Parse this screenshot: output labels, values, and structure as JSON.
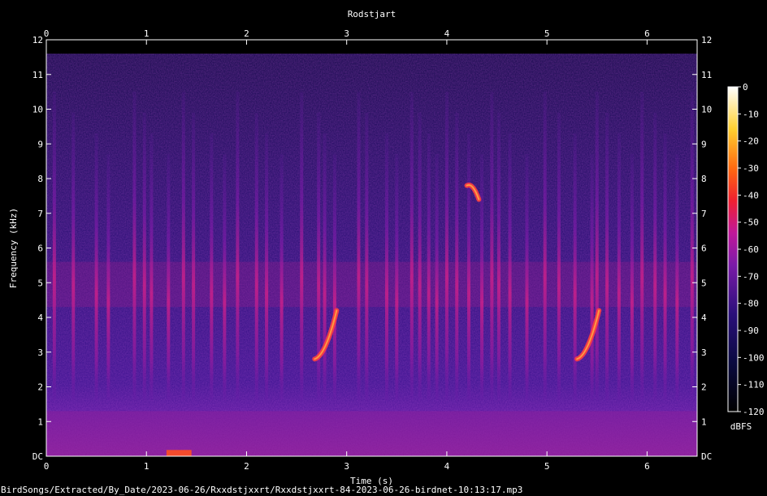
{
  "chart_data": {
    "type": "heatmap",
    "title": "Rodstjart",
    "xlabel": "Time (s)",
    "ylabel": "Frequency (kHz)",
    "xlim": [
      0,
      6.5
    ],
    "ylim": [
      0,
      12
    ],
    "x_ticks": [
      "0",
      "1",
      "2",
      "3",
      "4",
      "5",
      "6"
    ],
    "y_ticks": [
      "DC",
      "1",
      "2",
      "3",
      "4",
      "5",
      "6",
      "7",
      "8",
      "9",
      "10",
      "11",
      "12"
    ],
    "colorbar": {
      "label": "dBFS",
      "range": [
        -120,
        0
      ],
      "ticks": [
        "0",
        "-10",
        "-20",
        "-30",
        "-40",
        "-50",
        "-60",
        "-70",
        "-80",
        "-90",
        "-100",
        "-110",
        "-120"
      ]
    },
    "signal_upper_freq_khz": 11.6,
    "noise_floor_band_khz": [
      0,
      1.3
    ],
    "vertical_transients_s": [
      0.08,
      0.27,
      0.5,
      0.62,
      0.88,
      0.98,
      1.05,
      1.22,
      1.37,
      1.47,
      1.65,
      1.78,
      1.91,
      2.1,
      2.2,
      2.35,
      2.55,
      2.72,
      2.78,
      2.88,
      3.12,
      3.2,
      3.4,
      3.5,
      3.65,
      3.73,
      3.82,
      3.9,
      4.0,
      4.1,
      4.22,
      4.35,
      4.45,
      4.52,
      4.63,
      4.8,
      4.98,
      5.12,
      5.28,
      5.45,
      5.5,
      5.6,
      5.72,
      5.85,
      5.95,
      6.08,
      6.18,
      6.3,
      6.45
    ],
    "calls": [
      {
        "t_start": 2.68,
        "t_end": 2.9,
        "f_start_khz": 2.8,
        "f_end_khz": 4.2
      },
      {
        "t_start": 5.3,
        "t_end": 5.52,
        "f_start_khz": 2.8,
        "f_end_khz": 4.2
      },
      {
        "t_start": 4.2,
        "t_end": 4.32,
        "f_start_khz": 7.8,
        "f_end_khz": 7.4
      }
    ],
    "low_freq_hotspot": {
      "t_start": 1.2,
      "t_end": 1.45,
      "f_khz": 0.1
    }
  },
  "colors": {
    "background": "#000000",
    "axis": "#ffffff",
    "spectro_low": "#1c0a5e",
    "spectro_mid": "#7a1aa8",
    "spectro_high": "#ff3030",
    "hot": "#ffd040"
  },
  "footer": {
    "path": "BirdSongs/Extracted/By_Date/2023-06-26/Rxxdstjxxrt/Rxxdstjxxrt-84-2023-06-26-birdnet-10:13:17.mp3"
  }
}
